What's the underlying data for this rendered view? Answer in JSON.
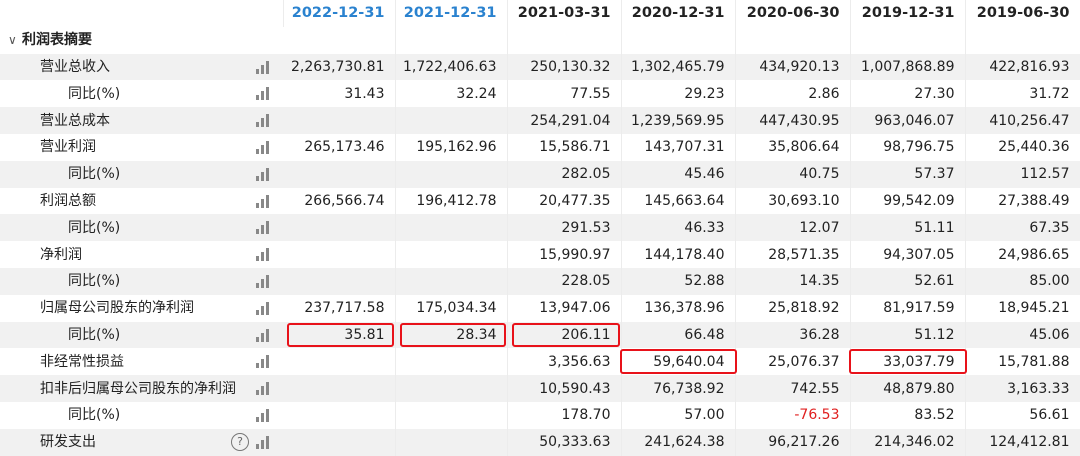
{
  "columns": [
    {
      "label": "2022-12-31",
      "highlight": true
    },
    {
      "label": "2021-12-31",
      "highlight": true
    },
    {
      "label": "2021-03-31",
      "highlight": false
    },
    {
      "label": "2020-12-31",
      "highlight": false
    },
    {
      "label": "2020-06-30",
      "highlight": false
    },
    {
      "label": "2019-12-31",
      "highlight": false
    },
    {
      "label": "2019-06-30",
      "highlight": false
    }
  ],
  "section": {
    "label": "利润表摘要",
    "expanded": true,
    "caret_icon": "chevron-down-icon"
  },
  "rows": [
    {
      "label": "营业总收入",
      "level": 1,
      "values": [
        "2,263,730.81",
        "1,722,406.63",
        "250,130.32",
        "1,302,465.79",
        "434,920.13",
        "1,007,868.89",
        "422,816.93"
      ]
    },
    {
      "label": "同比(%)",
      "level": 2,
      "values": [
        "31.43",
        "32.24",
        "77.55",
        "29.23",
        "2.86",
        "27.30",
        "31.72"
      ]
    },
    {
      "label": "营业总成本",
      "level": 1,
      "values": [
        "",
        "",
        "254,291.04",
        "1,239,569.95",
        "447,430.95",
        "963,046.07",
        "410,256.47"
      ]
    },
    {
      "label": "营业利润",
      "level": 1,
      "values": [
        "265,173.46",
        "195,162.96",
        "15,586.71",
        "143,707.31",
        "35,806.64",
        "98,796.75",
        "25,440.36"
      ]
    },
    {
      "label": "同比(%)",
      "level": 2,
      "values": [
        "",
        "",
        "282.05",
        "45.46",
        "40.75",
        "57.37",
        "112.57"
      ]
    },
    {
      "label": "利润总额",
      "level": 1,
      "values": [
        "266,566.74",
        "196,412.78",
        "20,477.35",
        "145,663.64",
        "30,693.10",
        "99,542.09",
        "27,388.49"
      ]
    },
    {
      "label": "同比(%)",
      "level": 2,
      "values": [
        "",
        "",
        "291.53",
        "46.33",
        "12.07",
        "51.11",
        "67.35"
      ]
    },
    {
      "label": "净利润",
      "level": 1,
      "values": [
        "",
        "",
        "15,990.97",
        "144,178.40",
        "28,571.35",
        "94,307.05",
        "24,986.65"
      ]
    },
    {
      "label": "同比(%)",
      "level": 2,
      "values": [
        "",
        "",
        "228.05",
        "52.88",
        "14.35",
        "52.61",
        "85.00"
      ]
    },
    {
      "label": "归属母公司股东的净利润",
      "level": 1,
      "values": [
        "237,717.58",
        "175,034.34",
        "13,947.06",
        "136,378.96",
        "25,818.92",
        "81,917.59",
        "18,945.21"
      ]
    },
    {
      "label": "同比(%)",
      "level": 2,
      "values": [
        "35.81",
        "28.34",
        "206.11",
        "66.48",
        "36.28",
        "51.12",
        "45.06"
      ],
      "boxed": [
        0,
        1,
        2
      ]
    },
    {
      "label": "非经常性损益",
      "level": 1,
      "values": [
        "",
        "",
        "3,356.63",
        "59,640.04",
        "25,076.37",
        "33,037.79",
        "15,781.88"
      ],
      "boxed": [
        3,
        5
      ]
    },
    {
      "label": "扣非后归属母公司股东的净利润",
      "level": 1,
      "values": [
        "",
        "",
        "10,590.43",
        "76,738.92",
        "742.55",
        "48,879.80",
        "3,163.33"
      ]
    },
    {
      "label": "同比(%)",
      "level": 2,
      "values": [
        "",
        "",
        "178.70",
        "57.00",
        "-76.53",
        "83.52",
        "56.61"
      ],
      "negative": [
        4
      ]
    },
    {
      "label": "研发支出",
      "level": 1,
      "help": true,
      "values": [
        "",
        "",
        "50,333.63",
        "241,624.38",
        "96,217.26",
        "214,346.02",
        "124,412.81"
      ]
    }
  ],
  "colors": {
    "header_highlight": "#2a82cf",
    "box": "#e8121a",
    "negative": "#e02020",
    "row_alt": "#f1f1f1"
  },
  "icons": {
    "row_chart": "bar-chart-icon",
    "help": "help-circle-icon"
  },
  "help_glyph": "?"
}
